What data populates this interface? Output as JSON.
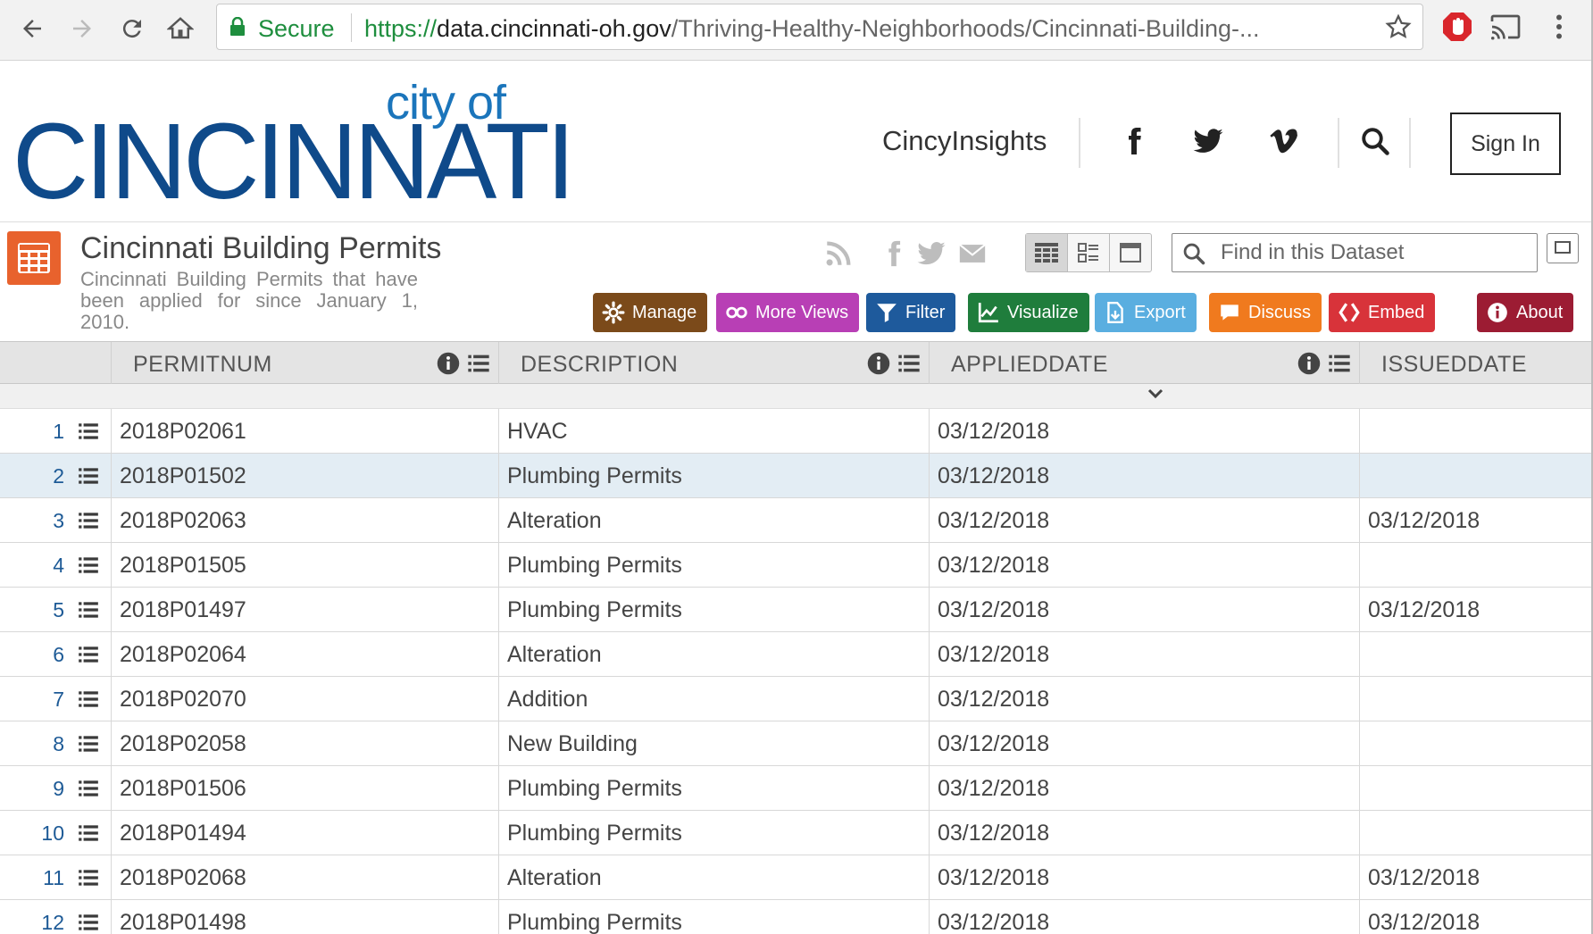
{
  "browser": {
    "secure_label": "Secure",
    "url_scheme": "https://",
    "url_host": "data.cincinnati-oh.gov",
    "url_path": "/Thriving-Healthy-Neighborhoods/Cincinnati-Building-..."
  },
  "site": {
    "logo_top": "city of",
    "logo_main": "CINCINNATI",
    "nav_link": "CincyInsights",
    "signin_label": "Sign In"
  },
  "dataset": {
    "title": "Cincinnati Building Permits",
    "description": "Cincinnati Building Permits that have been applied for since January 1, 2010.",
    "search_placeholder": "Find in this Dataset",
    "actions": [
      {
        "label": "Manage",
        "color": "#7b4a1a"
      },
      {
        "label": "More Views",
        "color": "#b83fb5"
      },
      {
        "label": "Filter",
        "color": "#1e5a9c"
      },
      {
        "label": "Visualize",
        "color": "#1f7d3c"
      },
      {
        "label": "Export",
        "color": "#5aaee0"
      },
      {
        "label": "Discuss",
        "color": "#f07a1e"
      },
      {
        "label": "Embed",
        "color": "#d8333a"
      },
      {
        "label": "About",
        "color": "#9c1c33"
      }
    ]
  },
  "grid": {
    "columns": [
      "PERMITNUM",
      "DESCRIPTION",
      "APPLIEDDATE",
      "ISSUEDDATE"
    ],
    "rows": [
      {
        "num": "1",
        "permitnum": "2018P02061",
        "description": "HVAC",
        "applieddate": "03/12/2018",
        "issueddate": ""
      },
      {
        "num": "2",
        "permitnum": "2018P01502",
        "description": "Plumbing Permits",
        "applieddate": "03/12/2018",
        "issueddate": ""
      },
      {
        "num": "3",
        "permitnum": "2018P02063",
        "description": "Alteration",
        "applieddate": "03/12/2018",
        "issueddate": "03/12/2018"
      },
      {
        "num": "4",
        "permitnum": "2018P01505",
        "description": "Plumbing Permits",
        "applieddate": "03/12/2018",
        "issueddate": ""
      },
      {
        "num": "5",
        "permitnum": "2018P01497",
        "description": "Plumbing Permits",
        "applieddate": "03/12/2018",
        "issueddate": "03/12/2018"
      },
      {
        "num": "6",
        "permitnum": "2018P02064",
        "description": "Alteration",
        "applieddate": "03/12/2018",
        "issueddate": ""
      },
      {
        "num": "7",
        "permitnum": "2018P02070",
        "description": "Addition",
        "applieddate": "03/12/2018",
        "issueddate": ""
      },
      {
        "num": "8",
        "permitnum": "2018P02058",
        "description": "New Building",
        "applieddate": "03/12/2018",
        "issueddate": ""
      },
      {
        "num": "9",
        "permitnum": "2018P01506",
        "description": "Plumbing Permits",
        "applieddate": "03/12/2018",
        "issueddate": ""
      },
      {
        "num": "10",
        "permitnum": "2018P01494",
        "description": "Plumbing Permits",
        "applieddate": "03/12/2018",
        "issueddate": ""
      },
      {
        "num": "11",
        "permitnum": "2018P02068",
        "description": "Alteration",
        "applieddate": "03/12/2018",
        "issueddate": "03/12/2018"
      },
      {
        "num": "12",
        "permitnum": "2018P01498",
        "description": "Plumbing Permits",
        "applieddate": "03/12/2018",
        "issueddate": "03/12/2018"
      }
    ],
    "selected_row": 2
  }
}
